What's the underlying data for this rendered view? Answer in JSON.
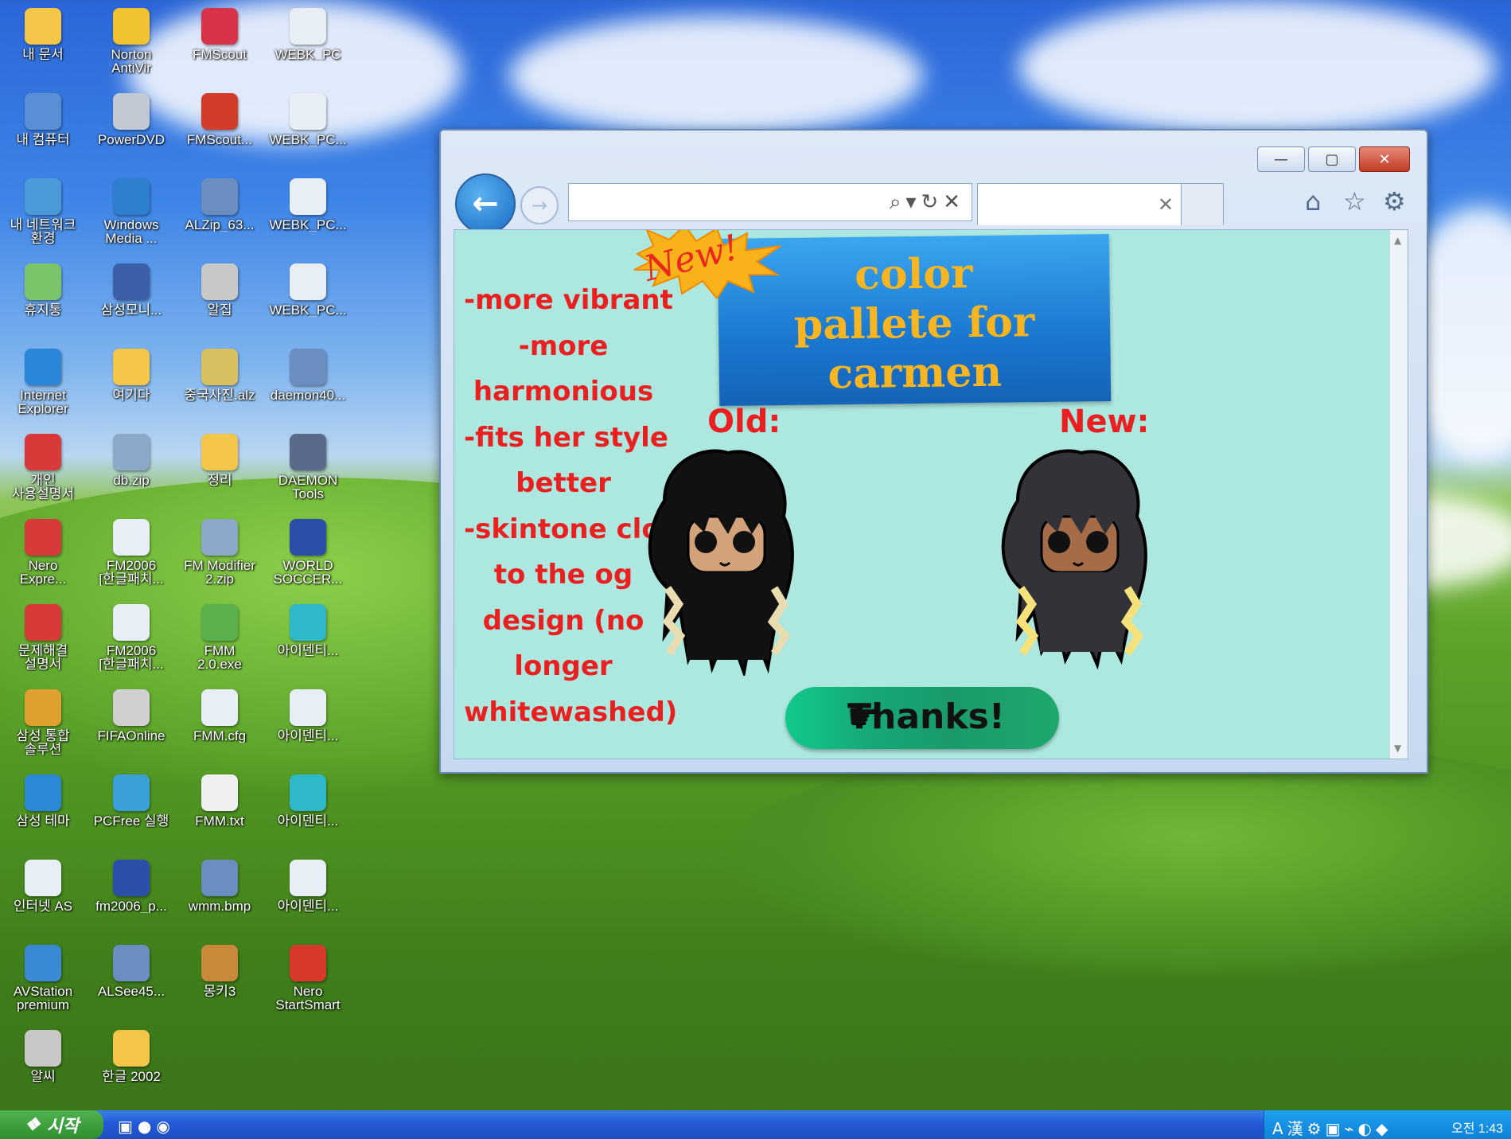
{
  "desktop": {
    "icons": [
      {
        "label": "내 문서",
        "icon": "folder-documents-icon",
        "color": "#f3c64a"
      },
      {
        "label": "Norton\nAntiVir",
        "icon": "norton-icon",
        "color": "#f1c232"
      },
      {
        "label": "FMScout",
        "icon": "fmscout-icon",
        "color": "#d9334a"
      },
      {
        "label": "WEBK_PC",
        "icon": "document-icon",
        "color": "#e8eef6"
      },
      {
        "label": "내 컴퓨터",
        "icon": "computer-icon",
        "color": "#5a8fd6"
      },
      {
        "label": "PowerDVD",
        "icon": "powerdvd-icon",
        "color": "#c0c8d4"
      },
      {
        "label": "FMScout...",
        "icon": "fm-scout-icon",
        "color": "#d23c2a"
      },
      {
        "label": "WEBK_PC...",
        "icon": "document-icon",
        "color": "#e8eef6"
      },
      {
        "label": "내 네트워크\n환경",
        "icon": "network-icon",
        "color": "#4a9ad8"
      },
      {
        "label": "Windows\nMedia ...",
        "icon": "media-player-icon",
        "color": "#2f7fd0"
      },
      {
        "label": "ALZip_63...",
        "icon": "alzip-icon",
        "color": "#6a8ec0"
      },
      {
        "label": "WEBK_PC...",
        "icon": "document-icon",
        "color": "#e8eef6"
      },
      {
        "label": "휴지통",
        "icon": "recycle-bin-icon",
        "color": "#7cc46a"
      },
      {
        "label": "삼성모니...",
        "icon": "samsung-monitor-icon",
        "color": "#3b5fa8"
      },
      {
        "label": "알집",
        "icon": "alzip-mascot-icon",
        "color": "#c8c8c8"
      },
      {
        "label": "WEBK_PC...",
        "icon": "document-icon",
        "color": "#e8eef6"
      },
      {
        "label": "Internet\nExplorer",
        "icon": "internet-explorer-icon",
        "color": "#2a86d8"
      },
      {
        "label": "여기다",
        "icon": "folder-icon",
        "color": "#f3c64a"
      },
      {
        "label": "중국사진.alz",
        "icon": "alz-archive-icon",
        "color": "#d8c060"
      },
      {
        "label": "daemon40...",
        "icon": "daemon-tools-icon",
        "color": "#6a8ec0"
      },
      {
        "label": "개인\n사용설명서",
        "icon": "pdf-icon",
        "color": "#d83a3a"
      },
      {
        "label": "db.zip",
        "icon": "zip-icon",
        "color": "#8aa8c8"
      },
      {
        "label": "정리",
        "icon": "folder-icon",
        "color": "#f3c64a"
      },
      {
        "label": "DAEMON\nTools",
        "icon": "daemon-tools-lightning-icon",
        "color": "#5a6a8a"
      },
      {
        "label": "Nero\nExpre...",
        "icon": "pdf-icon",
        "color": "#d83a3a"
      },
      {
        "label": "FM2006\n[한글패치...",
        "icon": "document-icon",
        "color": "#e8eef6"
      },
      {
        "label": "FM Modifier\n2.zip",
        "icon": "zip-icon",
        "color": "#8aa8c8"
      },
      {
        "label": "WORLD\nSOCCER...",
        "icon": "world-soccer-icon",
        "color": "#2a4fa8"
      },
      {
        "label": "문제해결\n설명서",
        "icon": "pdf-icon",
        "color": "#d83a3a"
      },
      {
        "label": "FM2006\n[한글패치...",
        "icon": "document-icon",
        "color": "#e8eef6"
      },
      {
        "label": "FMM\n2.0.exe",
        "icon": "fmm-icon",
        "color": "#5ab04a"
      },
      {
        "label": "아이덴티...",
        "icon": "identity-icon",
        "color": "#2fb8c8"
      },
      {
        "label": "삼성 통합\n솔루션",
        "icon": "samsung-solution-icon",
        "color": "#e0a030"
      },
      {
        "label": "FIFAOnline",
        "icon": "fifa-online-icon",
        "color": "#d0d0d0"
      },
      {
        "label": "FMM.cfg",
        "icon": "document-icon",
        "color": "#e8eef6"
      },
      {
        "label": "아이덴티...",
        "icon": "document-icon",
        "color": "#e8eef6"
      },
      {
        "label": "삼성 테마",
        "icon": "samsung-theme-icon",
        "color": "#2a8ad8"
      },
      {
        "label": "PCFree 실행",
        "icon": "pcfree-icon",
        "color": "#3aa0d8"
      },
      {
        "label": "FMM.txt",
        "icon": "text-file-icon",
        "color": "#f0f0f0"
      },
      {
        "label": "아이덴티...",
        "icon": "identity-icon",
        "color": "#2fb8c8"
      },
      {
        "label": "인터넷 AS",
        "icon": "document-icon",
        "color": "#e8eef6"
      },
      {
        "label": "fm2006_p...",
        "icon": "fm2006-icon",
        "color": "#2a4fa8"
      },
      {
        "label": "wmm.bmp",
        "icon": "bitmap-icon",
        "color": "#6a8ec0"
      },
      {
        "label": "아이덴티...",
        "icon": "document-icon",
        "color": "#e8eef6"
      },
      {
        "label": "AVStation\npremium",
        "icon": "avstation-icon",
        "color": "#3a8ad8"
      },
      {
        "label": "ALSee45...",
        "icon": "alsee-icon",
        "color": "#6a8ec0"
      },
      {
        "label": "몽키3",
        "icon": "monkey-icon",
        "color": "#c88a3a"
      },
      {
        "label": "Nero\nStartSmart",
        "icon": "nero-icon",
        "color": "#d83a2a"
      },
      {
        "label": "알씨",
        "icon": "alsee-mascot-icon",
        "color": "#c8c8c8"
      },
      {
        "label": "한글 2002",
        "icon": "folder-icon",
        "color": "#f3c64a"
      }
    ]
  },
  "browser": {
    "window_buttons": {
      "minimize": "—",
      "maximize": "▢",
      "close": "✕"
    },
    "address": {
      "value": "",
      "tools": "⌕▾↻✕"
    },
    "tab": {
      "title": "",
      "close": "✕"
    },
    "toolbar_icons": [
      "home-icon",
      "star-icon",
      "gear-icon"
    ],
    "page": {
      "notes": [
        "-more vibrant",
        "-more",
        "harmonious",
        "-fits her style",
        "better",
        "-skintone closer",
        "to the og",
        "design (no",
        "longer",
        "whitewashed)"
      ],
      "badge": "New!",
      "banner_lines": [
        "color",
        "pallete for",
        "carmen"
      ],
      "old_label": "Old:",
      "new_label": "New:",
      "button": "Thanks!"
    }
  },
  "colors": {
    "page_bg": "#ade8e0",
    "note_text": "#ea1f1f",
    "banner_text": "#f7b521",
    "button_green": "#16a97a"
  },
  "taskbar": {
    "start_label": "시작",
    "clock": "오전 1:43"
  }
}
